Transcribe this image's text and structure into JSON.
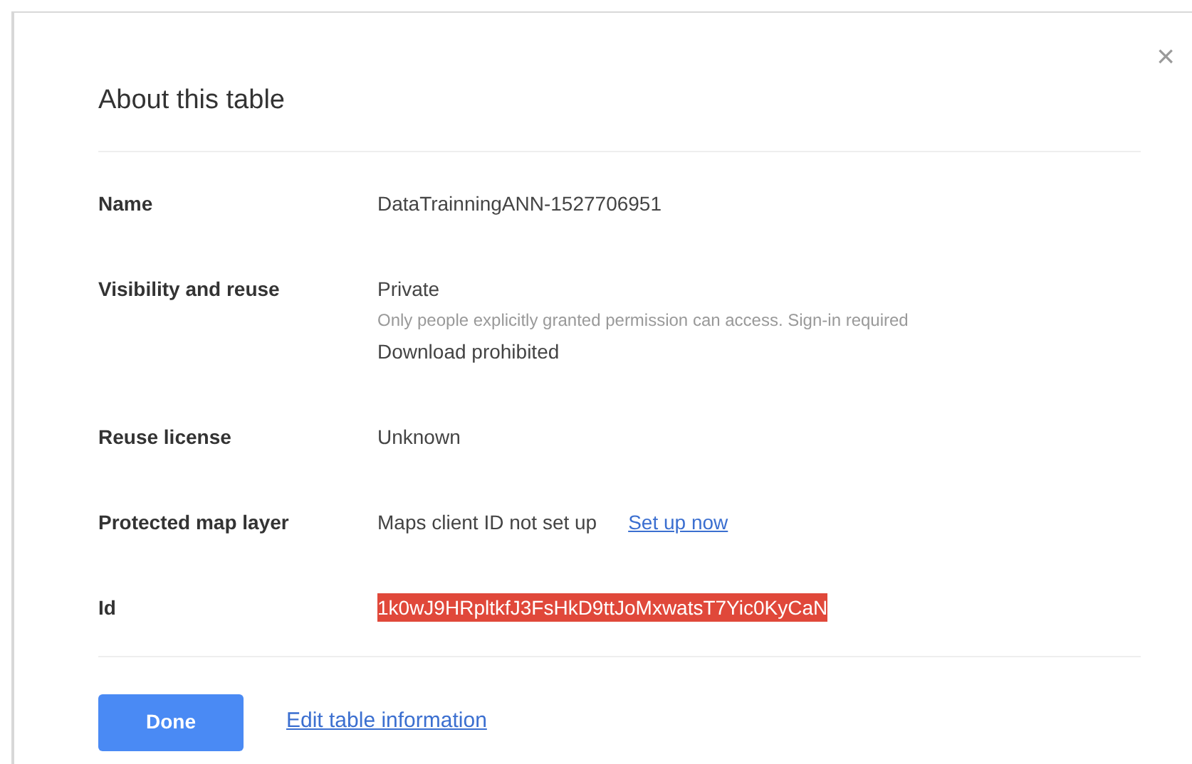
{
  "dialog": {
    "title": "About this table",
    "close": "×"
  },
  "rows": [
    {
      "label": "Name",
      "lines": [
        [
          {
            "kind": "value",
            "text": "DataTrainningANN-1527706951"
          }
        ]
      ]
    },
    {
      "label": "Visibility and reuse",
      "lines": [
        [
          {
            "kind": "value",
            "text": "Private"
          }
        ],
        [
          {
            "kind": "note",
            "text": "Only people explicitly granted permission can access. Sign-in required"
          }
        ],
        [
          {
            "kind": "value",
            "text": "Download prohibited"
          }
        ]
      ]
    },
    {
      "label": "Reuse license",
      "lines": [
        [
          {
            "kind": "value",
            "text": "Unknown"
          }
        ]
      ]
    },
    {
      "label": "Protected map layer",
      "lines": [
        [
          {
            "kind": "value",
            "text": "Maps client ID not set up"
          },
          {
            "kind": "link",
            "text": "Set up now"
          }
        ]
      ]
    },
    {
      "label": "Id",
      "lines": [
        [
          {
            "kind": "value",
            "text": "1k0wJ9HRpltkfJ3FsHkD9ttJoMxwatsT7Yic0KyCaN",
            "highlighted": true
          }
        ]
      ]
    }
  ],
  "buttons": {
    "primary": "Done",
    "link": "Edit table information"
  }
}
